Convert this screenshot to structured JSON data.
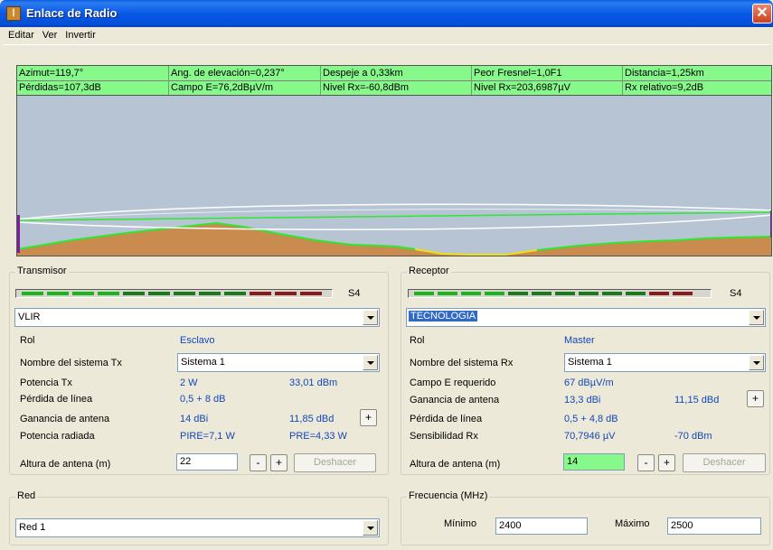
{
  "window": {
    "title": "Enlace de Radio",
    "close_glyph": "✕",
    "app_icon_text": "ꟾ"
  },
  "menu": [
    "Editar",
    "Ver",
    "Invertir"
  ],
  "info": {
    "row1": [
      "Azimut=119,7°",
      "Ang. de elevación=0,237°",
      "Despeje a 0,33km",
      "Peor Fresnel=1,0F1",
      "Distancia=1,25km"
    ],
    "row2": [
      "Pérdidas=107,3dB",
      "Campo E=76,2dBµV/m",
      "Nivel Rx=-60,8dBm",
      "Nivel Rx=203,6987µV",
      "Rx relativo=9,2dB"
    ]
  },
  "colors": {
    "accent_green": "#86f98a",
    "terrain": "#c98b4e",
    "sky": "#b6c4d3",
    "value_blue": "#1248b8"
  },
  "transmisor": {
    "group_label": "Transmisor",
    "signal_label": "S4",
    "system_name": "VLIR",
    "rol_label": "Rol",
    "rol_value": "Esclavo",
    "sistema_label": "Nombre del sistema Tx",
    "sistema_value": "Sistema  1",
    "potencia_label": "Potencia Tx",
    "potencia_w": "2 W",
    "potencia_dbm": "33,01 dBm",
    "perdida_label": "Pérdida de línea",
    "perdida_value": "0,5 + 8 dB",
    "ganancia_label": "Ganancia de antena",
    "ganancia_dbi": "14 dBi",
    "ganancia_dbd": "11,85 dBd",
    "radiada_label": "Potencia radiada",
    "pire": "PIRE=7,1 W",
    "pre": "PRE=4,33 W",
    "altura_label": "Altura de antena (m)",
    "altura_value": "22",
    "minus": "-",
    "plus": "+",
    "deshacer": "Deshacer"
  },
  "receptor": {
    "group_label": "Receptor",
    "signal_label": "S4",
    "system_name": "TECNOLOGIA",
    "rol_label": "Rol",
    "rol_value": "Master",
    "sistema_label": "Nombre del sistema Rx",
    "sistema_value": "Sistema  1",
    "campo_label": "Campo E requerido",
    "campo_value": "67 dBµV/m",
    "ganancia_label": "Ganancia de antena",
    "ganancia_dbi": "13,3 dBi",
    "ganancia_dbd": "11,15 dBd",
    "perdida_label": "Pérdida de línea",
    "perdida_value": "0,5 + 4,8 dB",
    "sens_label": "Sensibilidad Rx",
    "sens_uv": "70,7946 µV",
    "sens_dbm": "-70 dBm",
    "altura_label": "Altura de antena (m)",
    "altura_value": "14",
    "minus": "-",
    "plus": "+",
    "deshacer": "Deshacer"
  },
  "red": {
    "group_label": "Red",
    "value": "Red 1"
  },
  "frecuencia": {
    "group_label": "Frecuencia (MHz)",
    "min_label": "Mínimo",
    "min_value": "2400",
    "max_label": "Máximo",
    "max_value": "2500"
  }
}
